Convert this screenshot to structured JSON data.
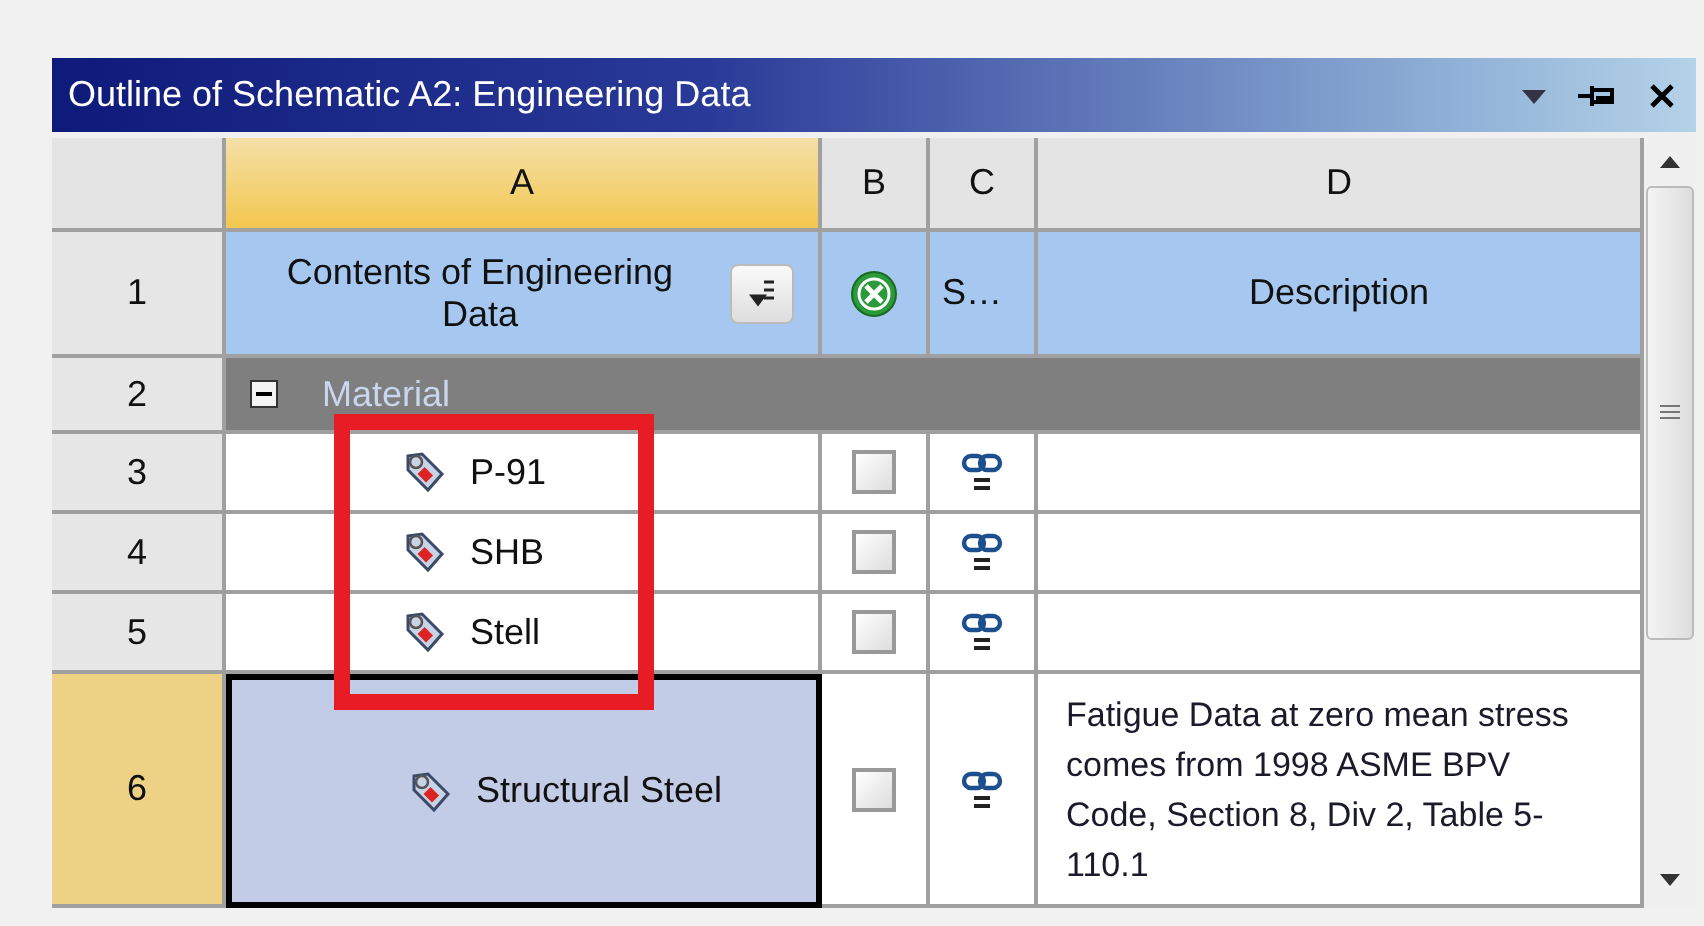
{
  "panel": {
    "title": "Outline of Schematic A2: Engineering Data"
  },
  "columns": [
    {
      "label": "A",
      "selected": true
    },
    {
      "label": "B",
      "selected": false
    },
    {
      "label": "C",
      "selected": false
    },
    {
      "label": "D",
      "selected": false
    }
  ],
  "header_row": {
    "number": "1",
    "contents": "Contents of Engineering Data",
    "source": "S…",
    "description": "Description"
  },
  "category": {
    "number": "2",
    "label": "Material",
    "expanded": true
  },
  "rows": [
    {
      "number": "3",
      "name": "P-91",
      "checked": false,
      "selected": false
    },
    {
      "number": "4",
      "name": "SHB",
      "checked": false,
      "selected": false
    },
    {
      "number": "5",
      "name": "Stell",
      "checked": false,
      "selected": false
    },
    {
      "number": "6",
      "name": "Structural Steel",
      "checked": false,
      "description": "Fatigue Data at zero mean stress comes from 1998 ASME BPV Code, Section 8, Div 2, Table 5-110.1",
      "selected": true
    }
  ]
}
